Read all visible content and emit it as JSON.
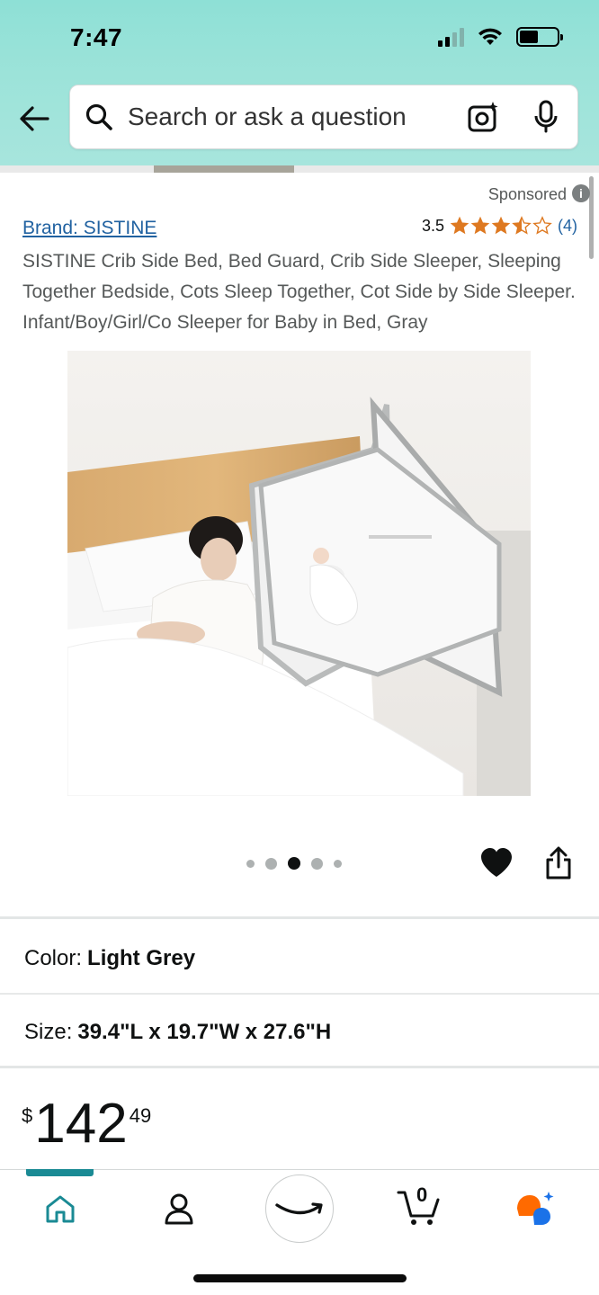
{
  "status_bar": {
    "time": "7:47"
  },
  "header": {
    "search_placeholder": "Search or ask a question"
  },
  "listing": {
    "sponsored_label": "Sponsored",
    "brand_link": "Brand: SISTINE",
    "rating_value": "3.5",
    "rating_stars": 3.5,
    "rating_count": "(4)",
    "title": "SISTINE Crib Side Bed, Bed Guard, Crib Side Sleeper, Sleeping Together Bedside, Cots Sleep Together, Cot Side by Side Sleeper. Infant/Boy/Girl/Co Sleeper for Baby in Bed, Gray",
    "image_count": 5,
    "active_image_index": 2
  },
  "options": {
    "color_label": "Color:",
    "color_value": "Light Grey",
    "size_label": "Size:",
    "size_value": "39.4\"L x 19.7\"W x 27.6\"H"
  },
  "price": {
    "currency": "$",
    "whole": "142",
    "fraction": "49"
  },
  "bottom_nav": {
    "items": [
      {
        "name": "home",
        "icon": "home-icon",
        "active": true
      },
      {
        "name": "account",
        "icon": "person-icon"
      },
      {
        "name": "menu",
        "icon": "amazon-smile-icon"
      },
      {
        "name": "cart",
        "icon": "cart-icon",
        "badge": "0"
      },
      {
        "name": "rufus",
        "icon": "rufus-icon"
      }
    ]
  },
  "colors": {
    "link": "#2162a1",
    "star": "#de7921",
    "accent_teal": "#1a8a94",
    "header_gradient_top": "#8ee0d6"
  }
}
